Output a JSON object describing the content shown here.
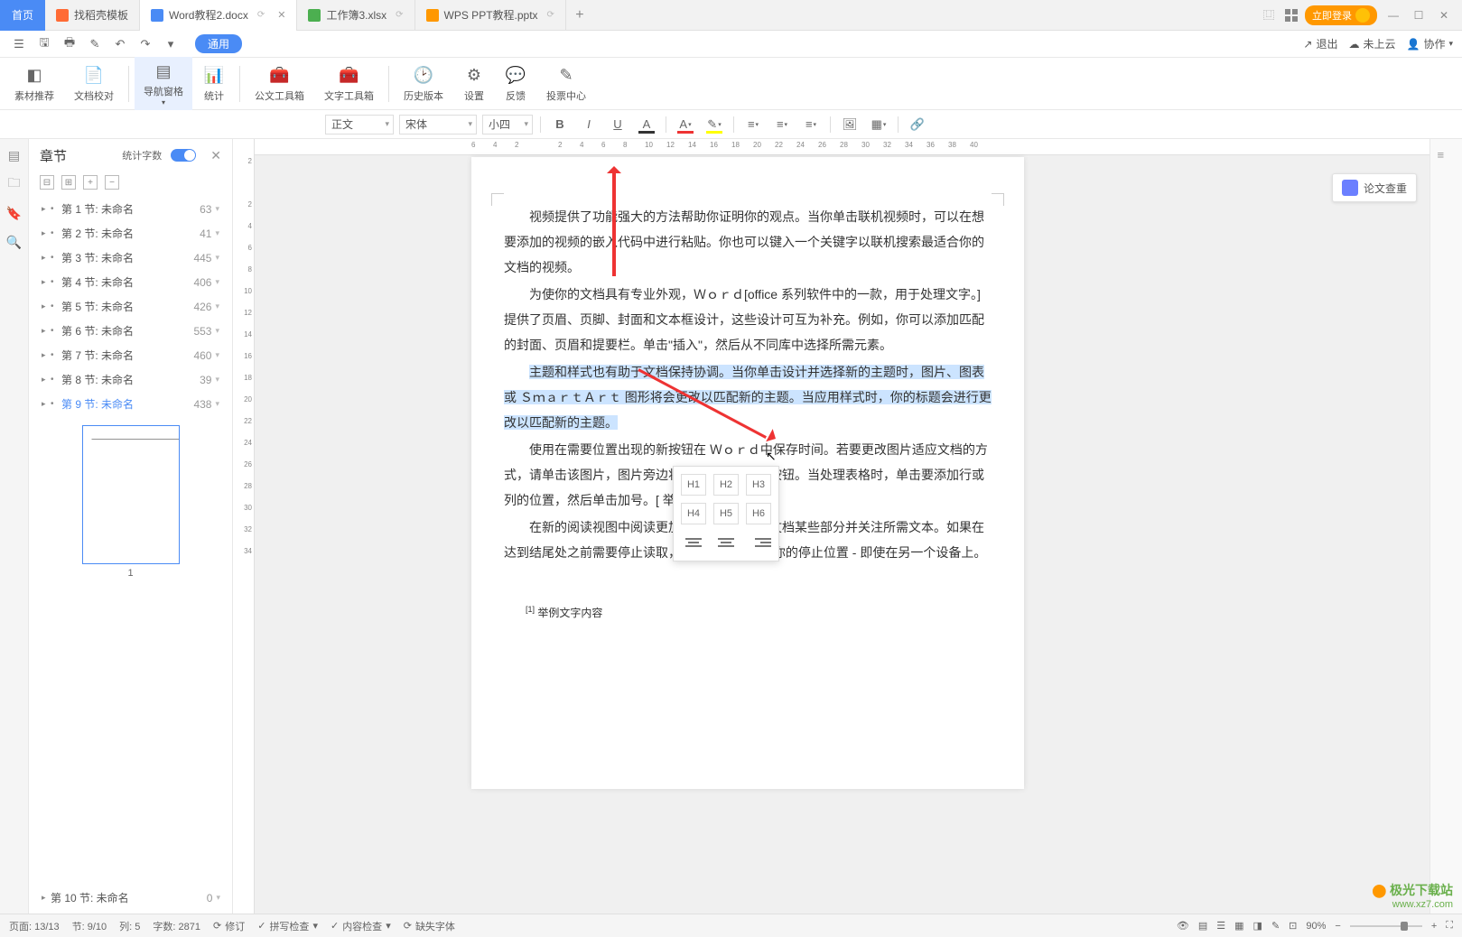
{
  "tabs": {
    "home": "首页",
    "items": [
      {
        "label": "找稻壳模板"
      },
      {
        "label": "Word教程2.docx"
      },
      {
        "label": "工作簿3.xlsx"
      },
      {
        "label": "WPS PPT教程.pptx"
      }
    ],
    "login": "立即登录"
  },
  "quickbar": {
    "tongyong": "通用",
    "right": {
      "exit": "退出",
      "notcloud": "未上云",
      "collab": "协作"
    }
  },
  "ribbon": {
    "items": [
      "素材推荐",
      "文档校对",
      "导航窗格",
      "统计",
      "公文工具箱",
      "文字工具箱",
      "历史版本",
      "设置",
      "反馈",
      "投票中心"
    ]
  },
  "format": {
    "style": "正文",
    "font": "宋体",
    "size": "小四"
  },
  "ruler_h": [
    "6",
    "4",
    "2",
    "",
    "2",
    "4",
    "6",
    "8",
    "10",
    "12",
    "14",
    "16",
    "18",
    "20",
    "22",
    "24",
    "26",
    "28",
    "30",
    "32",
    "34",
    "36",
    "38",
    "40"
  ],
  "ruler_v": [
    "2",
    "",
    "2",
    "4",
    "6",
    "8",
    "10",
    "12",
    "14",
    "16",
    "18",
    "20",
    "22",
    "24",
    "26",
    "28",
    "30",
    "32",
    "34"
  ],
  "chapter": {
    "title": "章节",
    "wordcount_label": "统计字数",
    "items": [
      {
        "name": "第 1 节: 未命名",
        "count": "63"
      },
      {
        "name": "第 2 节: 未命名",
        "count": "41"
      },
      {
        "name": "第 3 节: 未命名",
        "count": "445"
      },
      {
        "name": "第 4 节: 未命名",
        "count": "406"
      },
      {
        "name": "第 5 节: 未命名",
        "count": "426"
      },
      {
        "name": "第 6 节: 未命名",
        "count": "553"
      },
      {
        "name": "第 7 节: 未命名",
        "count": "460"
      },
      {
        "name": "第 8 节: 未命名",
        "count": "39"
      },
      {
        "name": "第 9 节: 未命名",
        "count": "438"
      }
    ],
    "section10": {
      "name": "第 10 节: 未命名",
      "count": "0"
    },
    "thumb_label": "1"
  },
  "heading_popup": {
    "row1": [
      "H1",
      "H2",
      "H3"
    ],
    "row2": [
      "H4",
      "H5",
      "H6"
    ]
  },
  "document": {
    "p1": "视频提供了功能强大的方法帮助你证明你的观点。当你单击联机视频时，可以在想要添加的视频的嵌入代码中进行粘贴。你也可以键入一个关键字以联机搜索最适合你的文档的视频。",
    "p2": "为使你的文档具有专业外观，Ｗｏｒｄ[office 系列软件中的一款，用于处理文字。] 提供了页眉、页脚、封面和文本框设计，这些设计可互为补充。例如，你可以添加匹配的封面、页眉和提要栏。单击\"插入\"，然后从不同库中选择所需元素。",
    "p3_a": "主题和样式也有助于文档保持协调。当你单击设计并选择新的主题时，图片、图表或 ＳｍａｒｔＡｒｔ 图形将会更改以匹配新的主题。",
    "p3_b": "当应用样式时，你的标题会进行更改以匹配新的主题。",
    "p4": "使用在需要位置出现的新按钮在 Ｗｏｒｄ中保存时间。若要更改图片适应文档的方式，请单击该图片，图片旁边将会显示布局选项按钮。当处理表格时，单击要添加行或列的位置，然后单击加号。[ 举例脚注内容。]",
    "p5": "在新的阅读视图中阅读更加容易。可以折叠文档某些部分并关注所需文本。如果在达到结尾处之前需要停止读取，Ｗｏｒｄ 会记住你的停止位置 - 即使在另一个设备上。",
    "footnote": "举例文字内容"
  },
  "paper_check": "论文查重",
  "status": {
    "page": "页面: 13/13",
    "section": "节: 9/10",
    "col": "列: 5",
    "words": "字数: 2871",
    "revise": "修订",
    "spell": "拼写检查",
    "content": "内容检查",
    "missfont": "缺失字体",
    "zoom": "90%"
  },
  "watermark": {
    "brand_a": "极光",
    "brand_b": "下载站",
    "url": "www.xz7.com"
  }
}
